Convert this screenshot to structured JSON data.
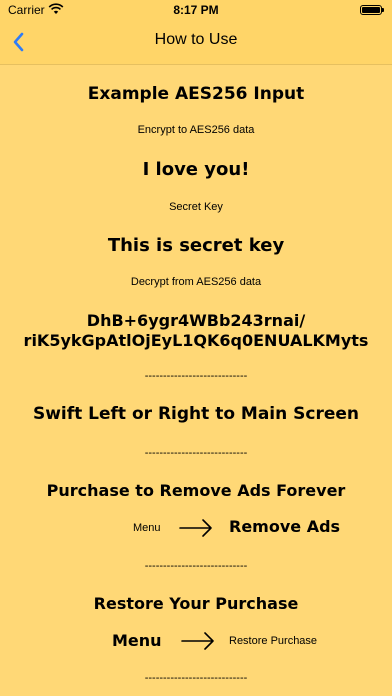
{
  "status_bar": {
    "carrier": "Carrier",
    "time": "8:17 PM",
    "wifi_icon": "wifi-icon",
    "battery_icon": "battery-icon"
  },
  "nav": {
    "title": "How to Use",
    "back_icon": "chevron-left-icon"
  },
  "content": {
    "example_title": "Example AES256 Input",
    "encrypt_label": "Encrypt to AES256 data",
    "encrypt_value": "I love you!",
    "key_label": "Secret Key",
    "key_value": "This is secret key",
    "decrypt_label": "Decrypt from AES256 data",
    "cipher_line1": "DhB+6ygr4WBb243rnai/",
    "cipher_line2": "riK5ykGpAtlOjEyL1QK6q0ENUALKMyts",
    "separator1": "----------------------------",
    "swipe_text": "Swift Left or Right to Main Screen",
    "separator2": "----------------------------",
    "purchase_title": "Purchase to Remove Ads Forever",
    "purchase_menu": "Menu",
    "purchase_target": "Remove Ads",
    "separator3": "----------------------------",
    "restore_title": "Restore Your Purchase",
    "restore_menu": "Menu",
    "restore_target": "Restore Purchase",
    "separator4": "----------------------------"
  },
  "colors": {
    "background": "#FFD876",
    "bar": "#FFD568",
    "accent": "#2F7CF6"
  }
}
